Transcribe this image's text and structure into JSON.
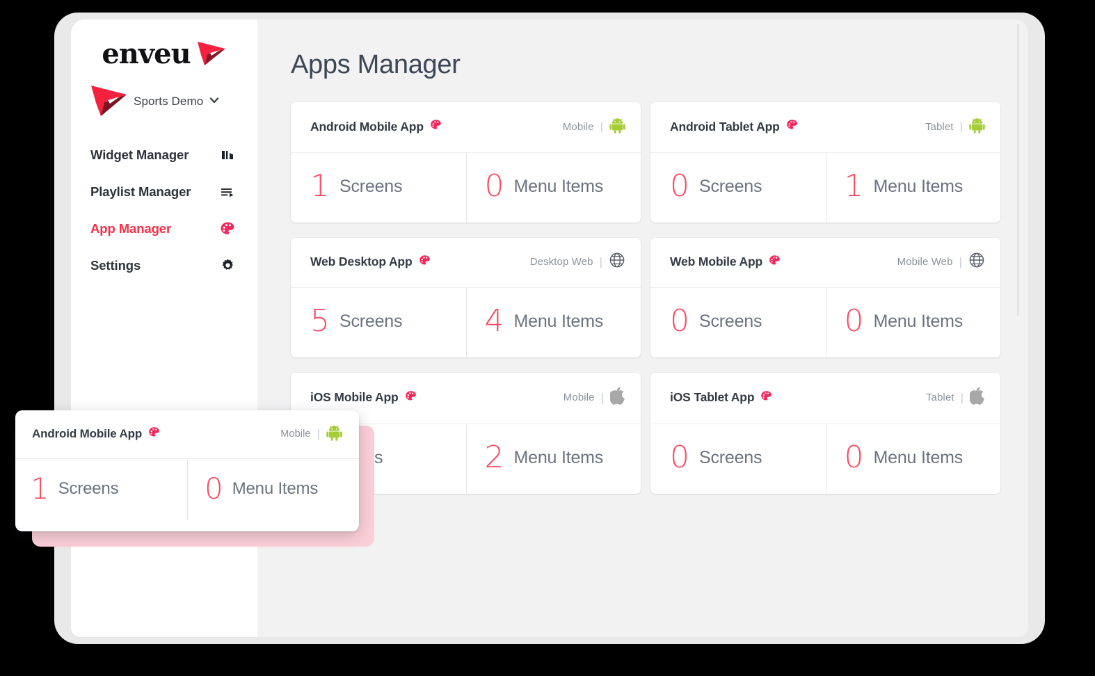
{
  "brand": {
    "logo_text": "enveu",
    "logo_icon": "paper-plane-icon"
  },
  "sidebar": {
    "tenant": {
      "icon": "paper-plane-icon",
      "name": "Sports Demo",
      "chevron": "chevron-down-icon"
    },
    "items": [
      {
        "label": "Widget Manager",
        "icon": "bar-chart-icon",
        "active": false
      },
      {
        "label": "Playlist Manager",
        "icon": "playlist-icon",
        "active": false
      },
      {
        "label": "App Manager",
        "icon": "palette-icon",
        "active": true
      },
      {
        "label": "Settings",
        "icon": "gear-icon",
        "active": false
      }
    ]
  },
  "main": {
    "title": "Apps Manager",
    "cards": [
      {
        "name": "Android Mobile App",
        "name_icon": "palette-icon",
        "platform_label": "Mobile",
        "platform_icon": "android-icon",
        "separator": "|",
        "stats": [
          {
            "value": "1",
            "label": "Screens"
          },
          {
            "value": "0",
            "label": "Menu Items"
          }
        ]
      },
      {
        "name": "Android Tablet App",
        "name_icon": "palette-icon",
        "platform_label": "Tablet",
        "platform_icon": "android-icon",
        "separator": "|",
        "stats": [
          {
            "value": "0",
            "label": "Screens"
          },
          {
            "value": "1",
            "label": "Menu Items"
          }
        ]
      },
      {
        "name": "Web Desktop App",
        "name_icon": "palette-icon",
        "platform_label": "Desktop Web",
        "platform_icon": "globe-icon",
        "separator": "|",
        "stats": [
          {
            "value": "5",
            "label": "Screens"
          },
          {
            "value": "4",
            "label": "Menu Items"
          }
        ]
      },
      {
        "name": "Web Mobile App",
        "name_icon": "palette-icon",
        "platform_label": "Mobile Web",
        "platform_icon": "globe-icon",
        "separator": "|",
        "stats": [
          {
            "value": "0",
            "label": "Screens"
          },
          {
            "value": "0",
            "label": "Menu Items"
          }
        ]
      },
      {
        "name": "iOS Mobile App",
        "name_icon": "palette-icon",
        "platform_label": "Mobile",
        "platform_icon": "apple-icon",
        "separator": "|",
        "stats": [
          {
            "value": "",
            "label": "Screens"
          },
          {
            "value": "2",
            "label": "Menu Items"
          }
        ]
      },
      {
        "name": "iOS Tablet App",
        "name_icon": "palette-icon",
        "platform_label": "Tablet",
        "platform_icon": "apple-icon",
        "separator": "|",
        "stats": [
          {
            "value": "0",
            "label": "Screens"
          },
          {
            "value": "0",
            "label": "Menu Items"
          }
        ]
      }
    ]
  },
  "overlay_card": {
    "name": "Android Mobile App",
    "name_icon": "palette-icon",
    "platform_label": "Mobile",
    "platform_icon": "android-icon",
    "separator": "|",
    "stats": [
      {
        "value": "1",
        "label": "Screens"
      },
      {
        "value": "0",
        "label": "Menu Items"
      }
    ]
  },
  "colors": {
    "accent_pink": "#fb4a62",
    "accent_red": "#fb2f48",
    "android_green": "#a5cd39",
    "apple_gray": "#a8a8a8",
    "title_slate": "#3c4656",
    "overlay_backdrop": "#fbcfd8",
    "canvas": "#f2f2f3",
    "bezel": "#e9e9ea"
  }
}
